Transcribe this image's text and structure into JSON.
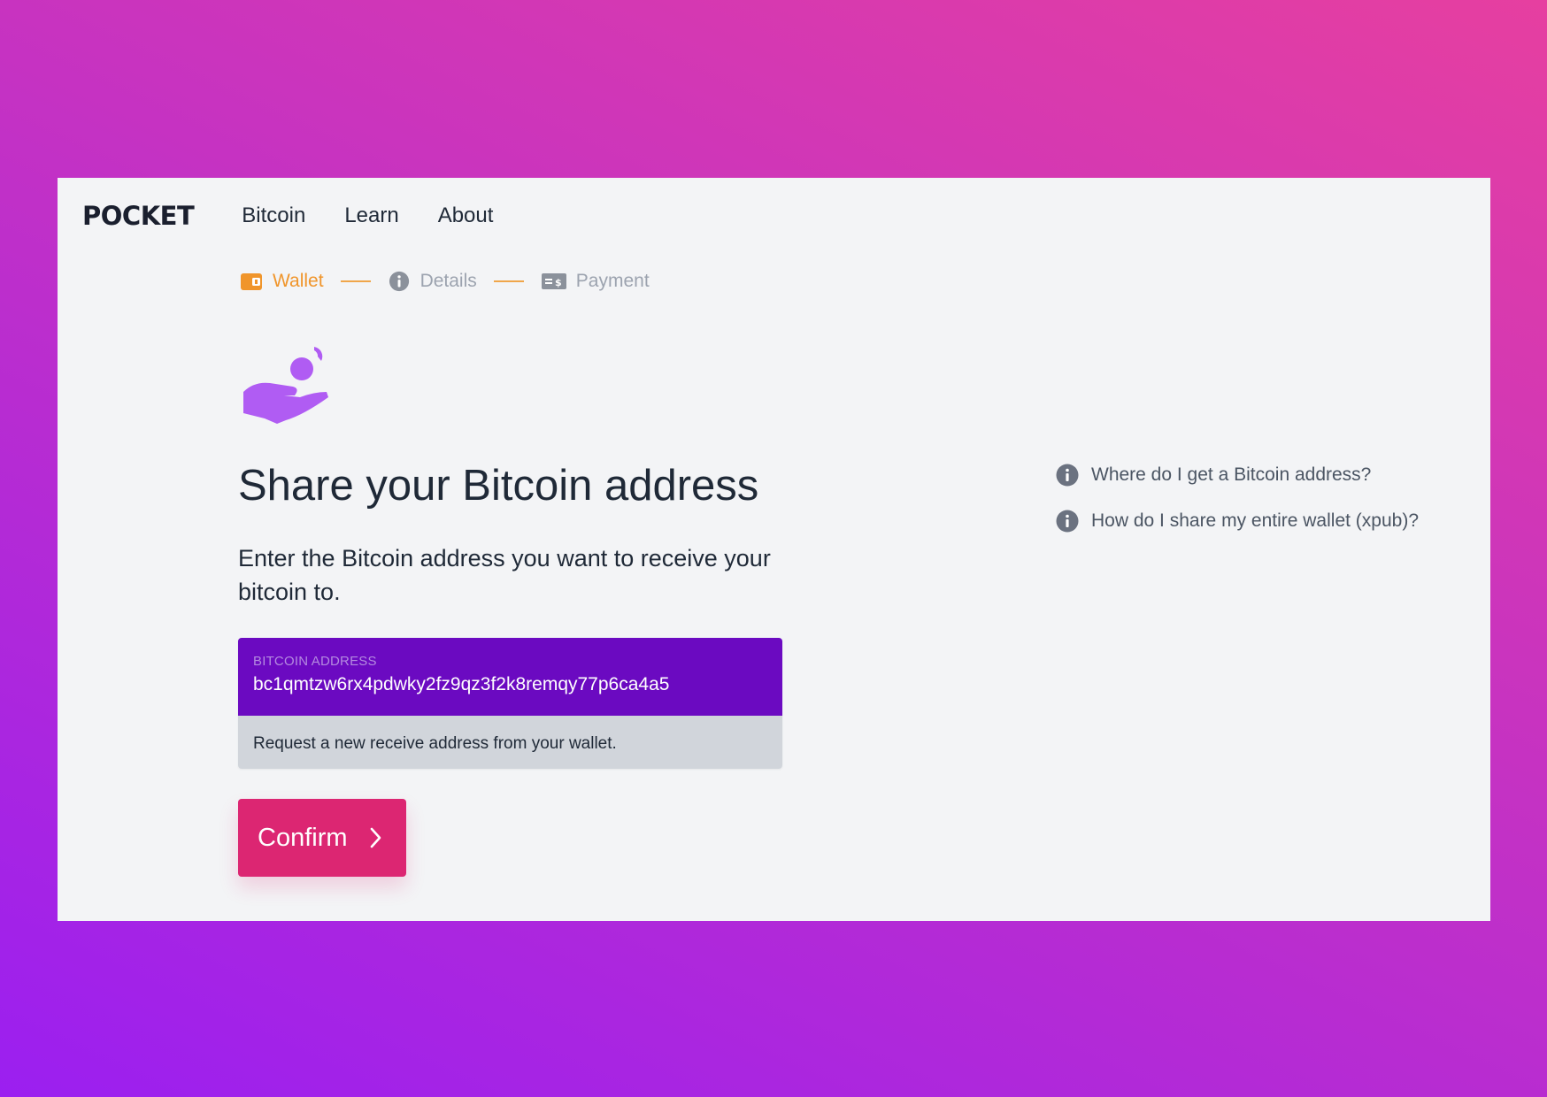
{
  "nav": {
    "logo": "POCKET",
    "links": [
      "Bitcoin",
      "Learn",
      "About"
    ]
  },
  "steps": [
    {
      "label": "Wallet",
      "icon": "wallet-icon",
      "active": true
    },
    {
      "label": "Details",
      "icon": "info-icon",
      "active": false
    },
    {
      "label": "Payment",
      "icon": "payment-icon",
      "active": false
    }
  ],
  "main": {
    "hero_icon": "hand-receiving-coin-icon",
    "title": "Share your Bitcoin address",
    "subtitle": "Enter the Bitcoin address you want to receive your bitcoin to.",
    "address": {
      "label": "Bitcoin Address",
      "value": "bc1qmtzw6rx4pdwky2fz9qz3f2k8remqy77p6ca4a5",
      "hint": "Request a new receive address from your wallet."
    },
    "confirm_label": "Confirm"
  },
  "faq": [
    "Where do I get a Bitcoin address?",
    "How do I share my entire wallet (xpub)?"
  ],
  "colors": {
    "accent_orange": "#f0952b",
    "input_purple": "#6b0ac1",
    "button_pink": "#dc2672",
    "hero_purple": "#b05cf3"
  }
}
